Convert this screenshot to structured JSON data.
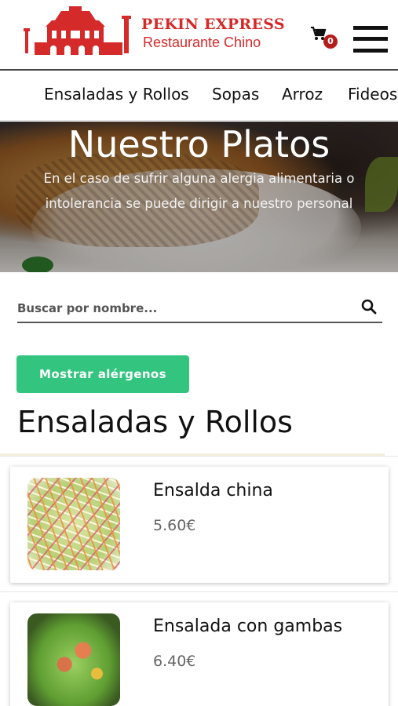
{
  "brand": {
    "name": "PEKIN EXPRESS",
    "subtitle": "Restaurante Chino",
    "color": "#d42a2a"
  },
  "header": {
    "cart_icon": "cart-icon",
    "cart_count": "0",
    "menu_icon": "hamburger-menu-icon"
  },
  "categories": [
    {
      "label": "Ensaladas y Rollos"
    },
    {
      "label": "Sopas"
    },
    {
      "label": "Arroz"
    },
    {
      "label": "Fideos"
    }
  ],
  "hero": {
    "title": "Nuestro Platos",
    "line1": "En el caso de sufrir alguna alergia alimentaria o",
    "line2": "intolerancia se puede dirigir a nuestro personal"
  },
  "search": {
    "placeholder": "Buscar por nombre...",
    "value": "",
    "icon": "search-icon"
  },
  "allergen_button": {
    "label": "Mostrar alérgenos",
    "color": "#33c47f"
  },
  "section": {
    "title": "Ensaladas y Rollos"
  },
  "dishes": [
    {
      "name": "Ensalda china",
      "price": "5.60€"
    },
    {
      "name": "Ensalada con gambas",
      "price": "6.40€"
    }
  ]
}
